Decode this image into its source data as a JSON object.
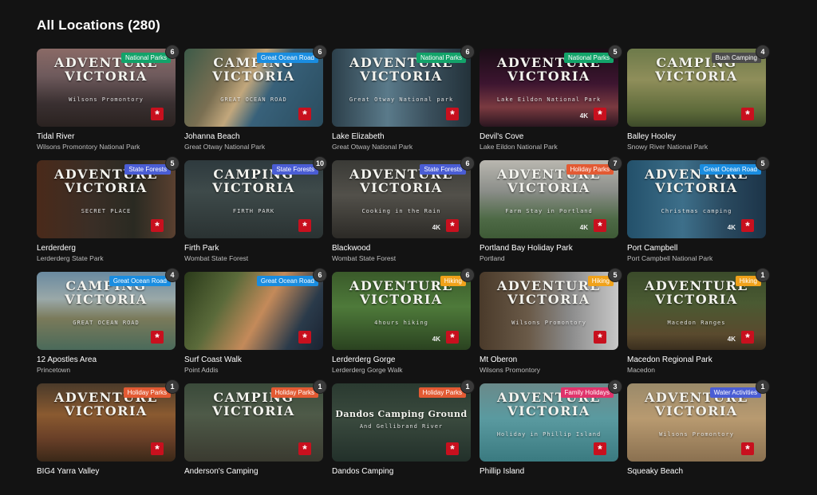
{
  "page": {
    "title": "All Locations (280)"
  },
  "category_colors": {
    "National Parks": "#13a36a",
    "Great Ocean Road": "#1a8de0",
    "Bush Camping": "#4b4b4b",
    "State Forests": "#4a5dd4",
    "Holiday Parks": "#e35a33",
    "Hiking": "#f0a21a",
    "Family Holidays": "#e0336b",
    "Water Activities": "#4a5dd4"
  },
  "locations": [
    {
      "name": "Tidal River",
      "park": "Wilsons Promontory National Park",
      "category": "National Parks",
      "count": "6",
      "overlay": "ADVENTURE\nVICTORIA",
      "sub": "Wilsons Promontory",
      "fourk": "",
      "bg": "linear-gradient(180deg,#8a6a66 0%,#6e5a5c 35%,#3a3031 70%,#2a2220 100%)"
    },
    {
      "name": "Johanna Beach",
      "park": "Great Otway National Park",
      "category": "Great Ocean Road",
      "count": "6",
      "overlay": "CAMPING\nVICTORIA",
      "sub": "GREAT OCEAN ROAD",
      "fourk": "",
      "bg": "linear-gradient(120deg,#3c5a48 0%,#7a6f52 30%,#c2a77c 45%,#38617a 60%,#2a4c5e 100%)"
    },
    {
      "name": "Lake Elizabeth",
      "park": "Great Otway National Park",
      "category": "National Parks",
      "count": "6",
      "overlay": "ADVENTURE\nVICTORIA",
      "sub": "Great Otway National park",
      "fourk": "",
      "bg": "linear-gradient(90deg,#2c3f4a 0%,#5a7a8a 40%,#3a4f5c 70%,#23323a 100%)"
    },
    {
      "name": "Devil's Cove",
      "park": "Lake Eildon National Park",
      "category": "National Parks",
      "count": "5",
      "overlay": "ADVENTURE\nVICTORIA",
      "sub": "Lake Eildon National Park",
      "fourk": "4K",
      "bg": "linear-gradient(180deg,#1a0d16 0%,#3d1530 45%,#7a3a40 75%,#2a1620 100%)"
    },
    {
      "name": "Balley Hooley",
      "park": "Snowy River National Park",
      "category": "Bush Camping",
      "count": "4",
      "overlay": "CAMPING\nVICTORIA",
      "sub": "",
      "fourk": "",
      "bg": "linear-gradient(180deg,#6d7a4a 0%,#8f8e5a 40%,#5d6a3a 80%,#3d4a2a 100%)"
    },
    {
      "name": "Lerderderg",
      "park": "Lerderderg State Park",
      "category": "State Forests",
      "count": "5",
      "overlay": "ADVENTURE\nVICTORIA",
      "sub": "SECRET PLACE",
      "fourk": "",
      "bg": "linear-gradient(90deg,#4a2a1a 0%,#3a2e26 40%,#2a2a22 70%,#5a4030 100%)"
    },
    {
      "name": "Firth Park",
      "park": "Wombat State Forest",
      "category": "State Forests",
      "count": "10",
      "overlay": "CAMPING\nVICTORIA",
      "sub": "FIRTH PARK",
      "fourk": "",
      "bg": "linear-gradient(180deg,#2e3a3e 0%,#3e4a4a 40%,#2a3232 100%)"
    },
    {
      "name": "Blackwood",
      "park": "Wombat State Forest",
      "category": "State Forests",
      "count": "6",
      "overlay": "ADVENTURE\nVICTORIA",
      "sub": "Cooking in the Rain",
      "fourk": "4K",
      "bg": "linear-gradient(180deg,#3a3a36 0%,#52504a 45%,#2c2a26 100%)"
    },
    {
      "name": "Portland Bay Holiday Park",
      "park": "Portland",
      "category": "Holiday Parks",
      "count": "7",
      "overlay": "ADVENTURE\nVICTORIA",
      "sub": "Farm Stay in Portland",
      "fourk": "4K",
      "bg": "linear-gradient(180deg,#b9b7b0 0%,#8a8d88 40%,#4e6a46 75%,#3e5a36 100%)"
    },
    {
      "name": "Port Campbell",
      "park": "Port Campbell National Park",
      "category": "Great Ocean Road",
      "count": "5",
      "overlay": "ADVENTURE\nVICTORIA",
      "sub": "Christmas camping",
      "fourk": "4K",
      "bg": "linear-gradient(90deg,#23506a 0%,#3d6f8a 40%,#2a4a60 70%,#1c3448 100%)"
    },
    {
      "name": "12 Apostles Area",
      "park": "Princetown",
      "category": "Great Ocean Road",
      "count": "4",
      "overlay": "CAMPING\nVICTORIA",
      "sub": "GREAT OCEAN ROAD",
      "fourk": "",
      "bg": "linear-gradient(180deg,#6a8aa0 0%,#9aa8a8 35%,#7a7a5a 60%,#4a6a5a 100%)"
    },
    {
      "name": "Surf Coast Walk",
      "park": "Point Addis",
      "category": "Great Ocean Road",
      "count": "6",
      "overlay": "",
      "sub": "",
      "fourk": "",
      "bg": "linear-gradient(120deg,#2a3a1a 0%,#5a6a3a 30%,#c48a5a 55%,#2a3a4a 80%,#1a2230 100%)"
    },
    {
      "name": "Lerderderg Gorge",
      "park": "Lerderderg Gorge Walk",
      "category": "Hiking",
      "count": "6",
      "overlay": "ADVENTURE\nVICTORIA",
      "sub": "4hours hiking",
      "fourk": "4K",
      "bg": "linear-gradient(180deg,#3a5a2a 0%,#4e7a3a 45%,#2a4220 100%)"
    },
    {
      "name": "Mt Oberon",
      "park": "Wilsons Promontory",
      "category": "Hiking",
      "count": "5",
      "overlay": "ADVENTURE\nVICTORIA",
      "sub": "Wilsons Promontory",
      "fourk": "",
      "bg": "linear-gradient(90deg,#4a3a2a 0%,#6a5a48 35%,#8a8a8a 65%,#c8c8c8 100%)"
    },
    {
      "name": "Macedon Regional Park",
      "park": "Macedon",
      "category": "Hiking",
      "count": "1",
      "overlay": "ADVENTURE\nVICTORIA",
      "sub": "Macedon Ranges",
      "fourk": "4K",
      "bg": "linear-gradient(180deg,#3a4a2a 0%,#4a5a32 40%,#5a4a2e 80%,#3a2e1e 100%)"
    },
    {
      "name": "BIG4 Yarra Valley",
      "park": "",
      "category": "Holiday Parks",
      "count": "1",
      "overlay": "ADVENTURE\nVICTORIA",
      "sub": "",
      "fourk": "",
      "bg": "linear-gradient(180deg,#4a3a2a 0%,#8a5a30 40%,#6a4028 70%,#3a2818 100%)"
    },
    {
      "name": "Anderson's Camping",
      "park": "",
      "category": "Holiday Parks",
      "count": "1",
      "overlay": "CAMPING\nVICTORIA",
      "sub": "",
      "fourk": "",
      "bg": "linear-gradient(180deg,#3a4a3a 0%,#4e5a48 40%,#3a3a30 100%)"
    },
    {
      "name": "Dandos Camping",
      "park": "",
      "category": "Holiday Parks",
      "count": "1",
      "overlay": "Dandos Camping Ground",
      "sub": "And Gellibrand River",
      "fourk": "",
      "bg": "linear-gradient(180deg,#2a3a30 0%,#3a4a3e 45%,#22302a 100%)"
    },
    {
      "name": "Phillip Island",
      "park": "",
      "category": "Family Holidays",
      "count": "3",
      "overlay": "ADVENTURE\nVICTORIA",
      "sub": "Holiday in Phillip Island",
      "fourk": "",
      "bg": "linear-gradient(180deg,#6a8a8a 0%,#5a9aa0 45%,#3a7a80 100%)"
    },
    {
      "name": "Squeaky Beach",
      "park": "",
      "category": "Water Activities",
      "count": "1",
      "overlay": "ADVENTURE\nVICTORIA",
      "sub": "Wilsons Promontory",
      "fourk": "",
      "bg": "linear-gradient(180deg,#9a8a6a 0%,#b89a70 45%,#8a7050 100%)"
    }
  ]
}
